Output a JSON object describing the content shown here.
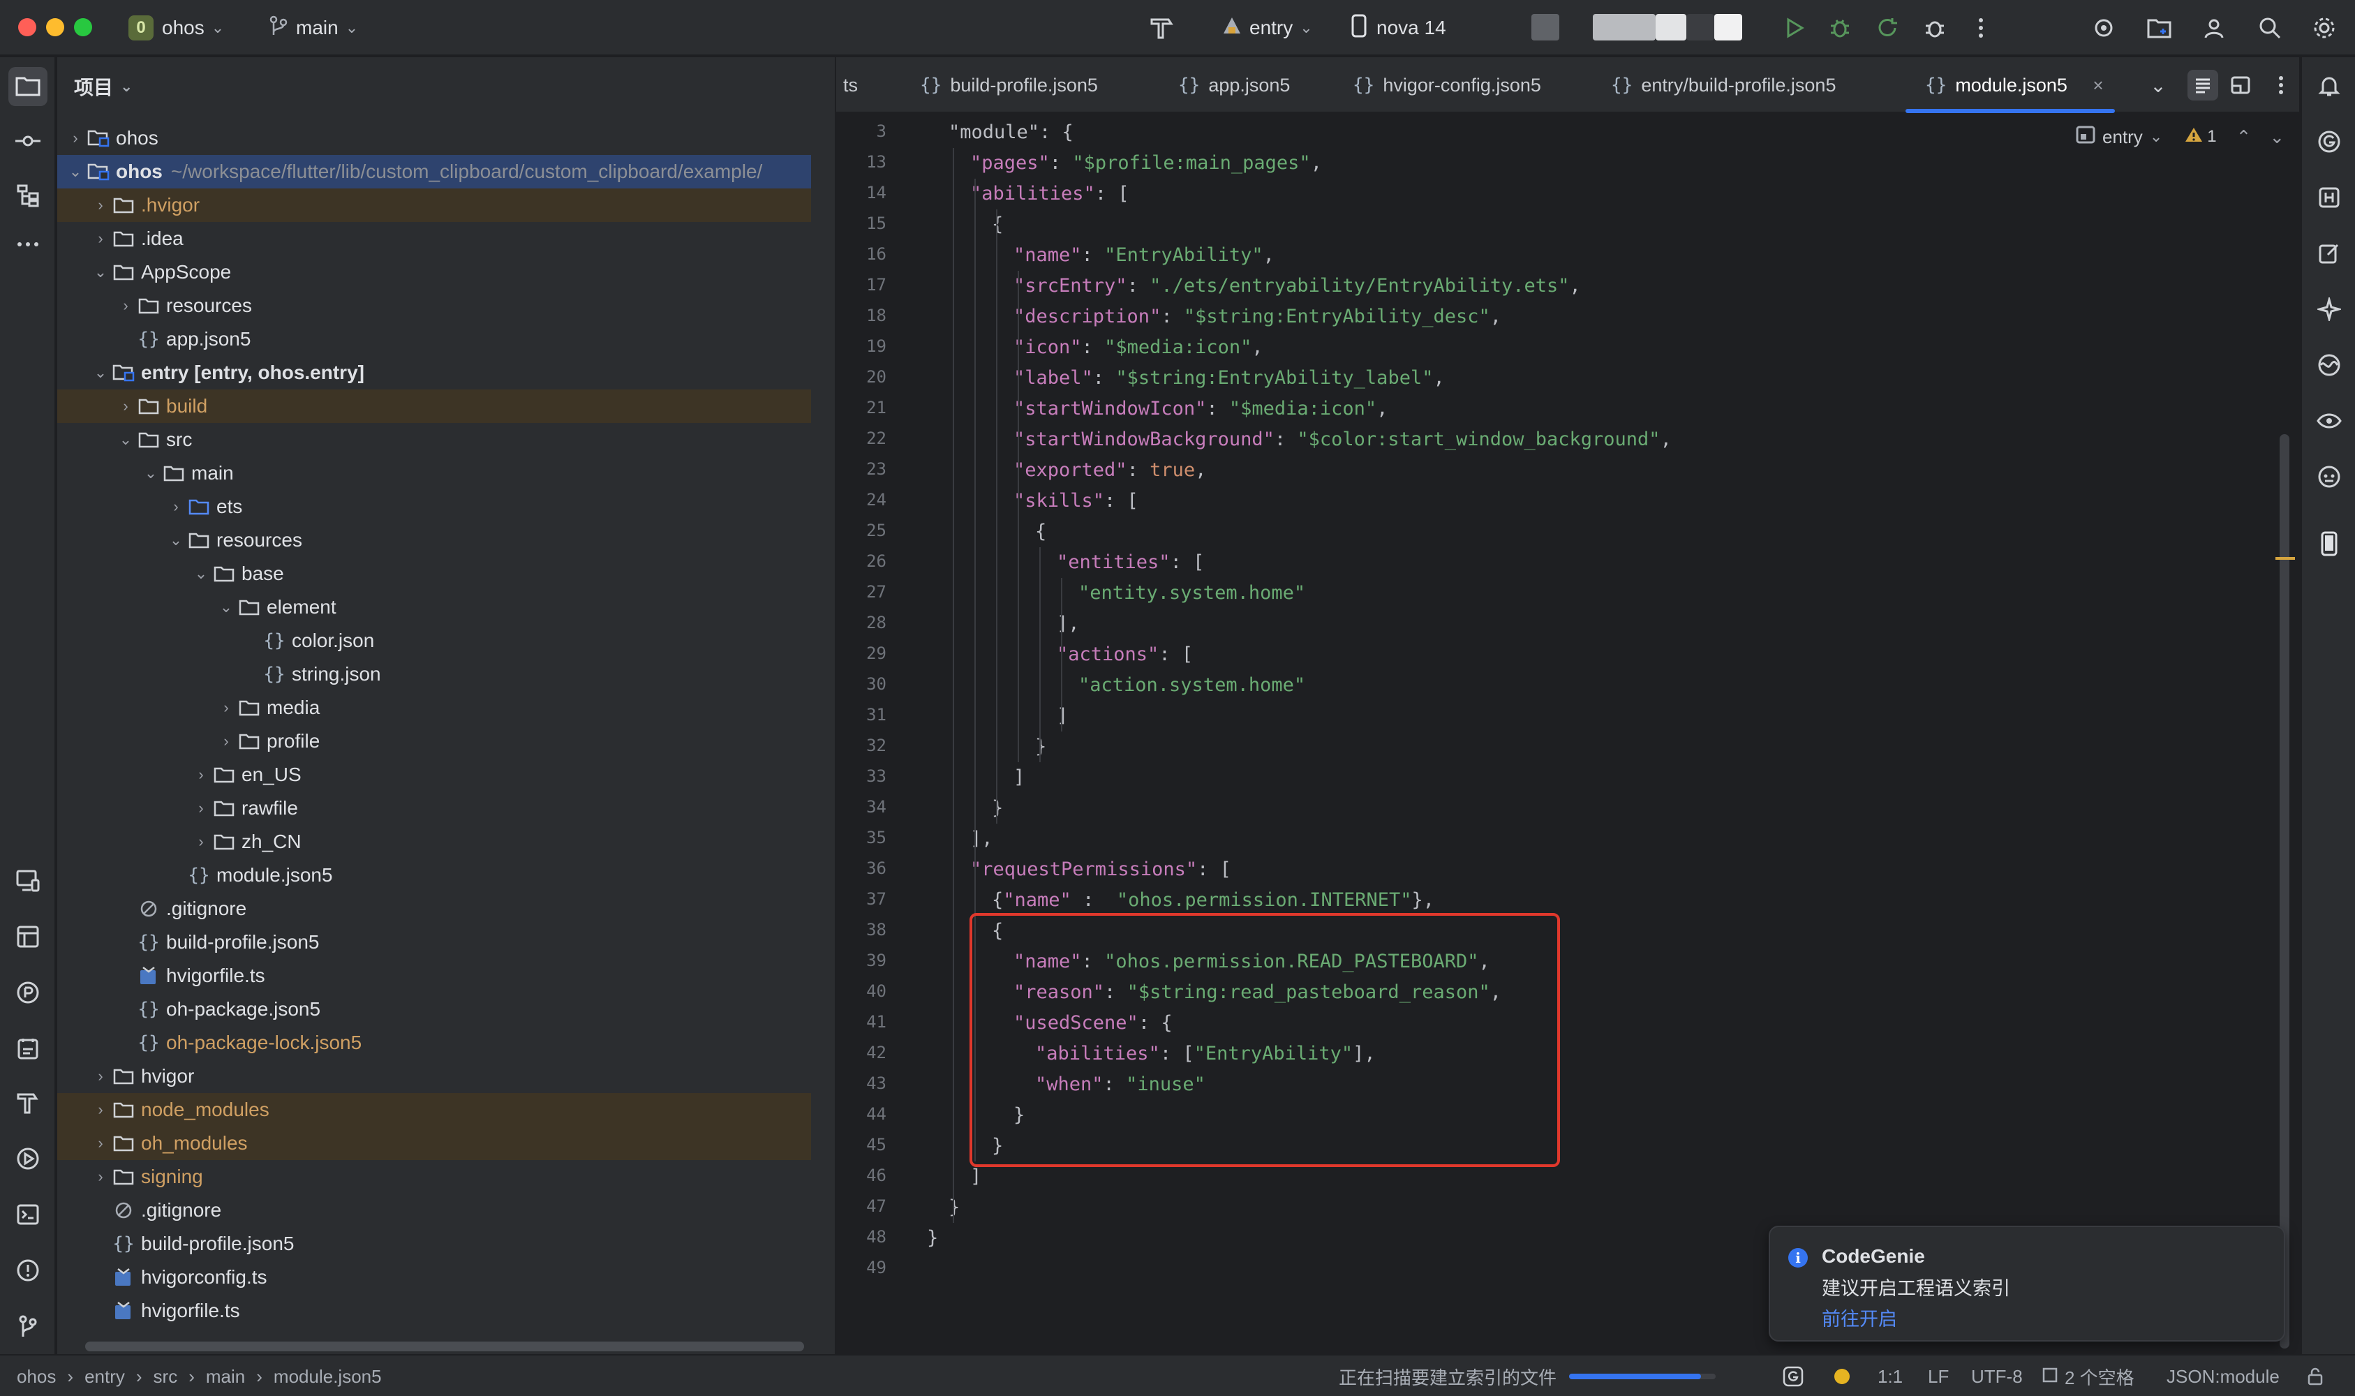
{
  "titlebar": {
    "project_badge": "0",
    "project_name": "ohos",
    "branch": "main",
    "run_config": "entry",
    "device": "nova 14"
  },
  "project_panel": {
    "title": "项目",
    "tree": [
      {
        "label": "ohos",
        "level": 0,
        "arrow": "›",
        "icon": "module-folder-icon",
        "style": "normal"
      },
      {
        "label": "ohos",
        "path": "~/workspace/flutter/lib/custom_clipboard/custom_clipboard/example/",
        "level": 0,
        "arrow": "⌄",
        "icon": "module-folder-icon",
        "style": "selected"
      },
      {
        "label": ".hvigor",
        "level": 1,
        "arrow": "›",
        "icon": "folder-icon",
        "style": "excluded"
      },
      {
        "label": ".idea",
        "level": 1,
        "arrow": "›",
        "icon": "folder-icon",
        "style": "normal"
      },
      {
        "label": "AppScope",
        "level": 1,
        "arrow": "⌄",
        "icon": "folder-icon",
        "style": "normal"
      },
      {
        "label": "resources",
        "level": 2,
        "arrow": "›",
        "icon": "folder-icon",
        "style": "normal"
      },
      {
        "label": "app.json5",
        "level": 2,
        "arrow": "",
        "icon": "json-icon",
        "style": "normal"
      },
      {
        "label": "entry [entry, ohos.entry]",
        "level": 1,
        "arrow": "⌄",
        "icon": "module-folder-icon",
        "style": "bold"
      },
      {
        "label": "build",
        "level": 2,
        "arrow": "›",
        "icon": "folder-icon",
        "style": "excluded"
      },
      {
        "label": "src",
        "level": 2,
        "arrow": "⌄",
        "icon": "folder-icon",
        "style": "normal"
      },
      {
        "label": "main",
        "level": 3,
        "arrow": "⌄",
        "icon": "folder-icon",
        "style": "normal"
      },
      {
        "label": "ets",
        "level": 4,
        "arrow": "›",
        "icon": "source-folder-icon",
        "style": "normal"
      },
      {
        "label": "resources",
        "level": 4,
        "arrow": "⌄",
        "icon": "folder-icon",
        "style": "normal"
      },
      {
        "label": "base",
        "level": 5,
        "arrow": "⌄",
        "icon": "folder-icon",
        "style": "normal"
      },
      {
        "label": "element",
        "level": 6,
        "arrow": "⌄",
        "icon": "folder-icon",
        "style": "normal"
      },
      {
        "label": "color.json",
        "level": 7,
        "arrow": "",
        "icon": "json-icon",
        "style": "normal"
      },
      {
        "label": "string.json",
        "level": 7,
        "arrow": "",
        "icon": "json-icon",
        "style": "normal"
      },
      {
        "label": "media",
        "level": 6,
        "arrow": "›",
        "icon": "folder-icon",
        "style": "normal"
      },
      {
        "label": "profile",
        "level": 6,
        "arrow": "›",
        "icon": "folder-icon",
        "style": "normal"
      },
      {
        "label": "en_US",
        "level": 5,
        "arrow": "›",
        "icon": "folder-icon",
        "style": "normal"
      },
      {
        "label": "rawfile",
        "level": 5,
        "arrow": "›",
        "icon": "folder-icon",
        "style": "normal"
      },
      {
        "label": "zh_CN",
        "level": 5,
        "arrow": "›",
        "icon": "folder-icon",
        "style": "normal"
      },
      {
        "label": "module.json5",
        "level": 4,
        "arrow": "",
        "icon": "json-icon",
        "style": "normal"
      },
      {
        "label": ".gitignore",
        "level": 2,
        "arrow": "",
        "icon": "ignore-icon",
        "style": "normal"
      },
      {
        "label": "build-profile.json5",
        "level": 2,
        "arrow": "",
        "icon": "json-icon",
        "style": "normal"
      },
      {
        "label": "hvigorfile.ts",
        "level": 2,
        "arrow": "",
        "icon": "ts-icon",
        "style": "normal"
      },
      {
        "label": "oh-package.json5",
        "level": 2,
        "arrow": "",
        "icon": "json-icon",
        "style": "normal"
      },
      {
        "label": "oh-package-lock.json5",
        "level": 2,
        "arrow": "",
        "icon": "json-icon",
        "style": "orange"
      },
      {
        "label": "hvigor",
        "level": 1,
        "arrow": "›",
        "icon": "folder-icon",
        "style": "normal"
      },
      {
        "label": "node_modules",
        "level": 1,
        "arrow": "›",
        "icon": "folder-icon",
        "style": "excluded"
      },
      {
        "label": "oh_modules",
        "level": 1,
        "arrow": "›",
        "icon": "folder-icon",
        "style": "excluded"
      },
      {
        "label": "signing",
        "level": 1,
        "arrow": "›",
        "icon": "folder-icon",
        "style": "orange"
      },
      {
        "label": ".gitignore",
        "level": 1,
        "arrow": "",
        "icon": "ignore-icon",
        "style": "normal"
      },
      {
        "label": "build-profile.json5",
        "level": 1,
        "arrow": "",
        "icon": "json-icon",
        "style": "normal"
      },
      {
        "label": "hvigorconfig.ts",
        "level": 1,
        "arrow": "",
        "icon": "ts-icon",
        "style": "normal"
      },
      {
        "label": "hvigorfile.ts",
        "level": 1,
        "arrow": "",
        "icon": "ts-icon",
        "style": "normal"
      }
    ]
  },
  "editor": {
    "tabs": [
      {
        "label": "ts",
        "active": false,
        "icon": false
      },
      {
        "label": "build-profile.json5",
        "active": false,
        "icon": true
      },
      {
        "label": "app.json5",
        "active": false,
        "icon": true
      },
      {
        "label": "hvigor-config.json5",
        "active": false,
        "icon": true
      },
      {
        "label": "entry/build-profile.json5",
        "active": false,
        "icon": true
      },
      {
        "label": "module.json5",
        "active": true,
        "icon": true
      }
    ],
    "context": "entry",
    "warning_count": "1",
    "lines": [
      {
        "n": "3",
        "indent": 1,
        "t": [
          [
            "p",
            "\"module\": {"
          ]
        ]
      },
      {
        "n": "13",
        "indent": 2,
        "t": [
          [
            "k",
            "\"pages\""
          ],
          [
            "p",
            ": "
          ],
          [
            "s",
            "\"$profile:main_pages\""
          ],
          [
            "p",
            ","
          ]
        ]
      },
      {
        "n": "14",
        "indent": 2,
        "t": [
          [
            "k",
            "\"abilities\""
          ],
          [
            "p",
            ": ["
          ]
        ]
      },
      {
        "n": "15",
        "indent": 3,
        "t": [
          [
            "p",
            "{"
          ]
        ]
      },
      {
        "n": "16",
        "indent": 4,
        "t": [
          [
            "k",
            "\"name\""
          ],
          [
            "p",
            ": "
          ],
          [
            "s",
            "\"EntryAbility\""
          ],
          [
            "p",
            ","
          ]
        ]
      },
      {
        "n": "17",
        "indent": 4,
        "t": [
          [
            "k",
            "\"srcEntry\""
          ],
          [
            "p",
            ": "
          ],
          [
            "s",
            "\"./ets/entryability/EntryAbility.ets\""
          ],
          [
            "p",
            ","
          ]
        ]
      },
      {
        "n": "18",
        "indent": 4,
        "t": [
          [
            "k",
            "\"description\""
          ],
          [
            "p",
            ": "
          ],
          [
            "s",
            "\"$string:EntryAbility_desc\""
          ],
          [
            "p",
            ","
          ]
        ]
      },
      {
        "n": "19",
        "indent": 4,
        "t": [
          [
            "k",
            "\"icon\""
          ],
          [
            "p",
            ": "
          ],
          [
            "s",
            "\"$media:icon\""
          ],
          [
            "p",
            ","
          ]
        ]
      },
      {
        "n": "20",
        "indent": 4,
        "t": [
          [
            "k",
            "\"label\""
          ],
          [
            "p",
            ": "
          ],
          [
            "s",
            "\"$string:EntryAbility_label\""
          ],
          [
            "p",
            ","
          ]
        ]
      },
      {
        "n": "21",
        "indent": 4,
        "t": [
          [
            "k",
            "\"startWindowIcon\""
          ],
          [
            "p",
            ": "
          ],
          [
            "s",
            "\"$media:icon\""
          ],
          [
            "p",
            ","
          ]
        ]
      },
      {
        "n": "22",
        "indent": 4,
        "t": [
          [
            "k",
            "\"startWindowBackground\""
          ],
          [
            "p",
            ": "
          ],
          [
            "s",
            "\"$color:start_window_background\""
          ],
          [
            "p",
            ","
          ]
        ]
      },
      {
        "n": "23",
        "indent": 4,
        "t": [
          [
            "k",
            "\"exported\""
          ],
          [
            "p",
            ": "
          ],
          [
            "b",
            "true"
          ],
          [
            "p",
            ","
          ]
        ]
      },
      {
        "n": "24",
        "indent": 4,
        "t": [
          [
            "k",
            "\"skills\""
          ],
          [
            "p",
            ": ["
          ]
        ]
      },
      {
        "n": "25",
        "indent": 5,
        "t": [
          [
            "p",
            "{"
          ]
        ]
      },
      {
        "n": "26",
        "indent": 6,
        "t": [
          [
            "k",
            "\"entities\""
          ],
          [
            "p",
            ": ["
          ]
        ]
      },
      {
        "n": "27",
        "indent": 7,
        "t": [
          [
            "s",
            "\"entity.system.home\""
          ]
        ]
      },
      {
        "n": "28",
        "indent": 6,
        "t": [
          [
            "p",
            "],"
          ]
        ]
      },
      {
        "n": "29",
        "indent": 6,
        "t": [
          [
            "k",
            "\"actions\""
          ],
          [
            "p",
            ": ["
          ]
        ]
      },
      {
        "n": "30",
        "indent": 7,
        "t": [
          [
            "s",
            "\"action.system.home\""
          ]
        ]
      },
      {
        "n": "31",
        "indent": 6,
        "t": [
          [
            "p",
            "]"
          ]
        ]
      },
      {
        "n": "32",
        "indent": 5,
        "t": [
          [
            "p",
            "}"
          ]
        ]
      },
      {
        "n": "33",
        "indent": 4,
        "t": [
          [
            "p",
            "]"
          ]
        ]
      },
      {
        "n": "34",
        "indent": 3,
        "t": [
          [
            "p",
            "}"
          ]
        ]
      },
      {
        "n": "35",
        "indent": 2,
        "t": [
          [
            "p",
            "],"
          ]
        ]
      },
      {
        "n": "36",
        "indent": 2,
        "t": [
          [
            "k",
            "\"requestPermissions\""
          ],
          [
            "p",
            ": ["
          ]
        ]
      },
      {
        "n": "37",
        "indent": 3,
        "t": [
          [
            "p",
            "{"
          ],
          [
            "k",
            "\"name\""
          ],
          [
            "p",
            " :  "
          ],
          [
            "s",
            "\"ohos.permission.INTERNET\""
          ],
          [
            "p",
            "},"
          ]
        ]
      },
      {
        "n": "38",
        "indent": 3,
        "t": [
          [
            "p",
            "{"
          ]
        ]
      },
      {
        "n": "39",
        "indent": 4,
        "t": [
          [
            "k",
            "\"name\""
          ],
          [
            "p",
            ": "
          ],
          [
            "s",
            "\"ohos.permission.READ_PASTEBOARD\""
          ],
          [
            "p",
            ","
          ]
        ]
      },
      {
        "n": "40",
        "indent": 4,
        "t": [
          [
            "k",
            "\"reason\""
          ],
          [
            "p",
            ": "
          ],
          [
            "s",
            "\"$string:read_pasteboard_reason\""
          ],
          [
            "p",
            ","
          ]
        ]
      },
      {
        "n": "41",
        "indent": 4,
        "t": [
          [
            "k",
            "\"usedScene\""
          ],
          [
            "p",
            ": {"
          ]
        ]
      },
      {
        "n": "42",
        "indent": 5,
        "t": [
          [
            "k",
            "\"abilities\""
          ],
          [
            "p",
            ": ["
          ],
          [
            "s",
            "\"EntryAbility\""
          ],
          [
            "p",
            "],"
          ]
        ]
      },
      {
        "n": "43",
        "indent": 5,
        "t": [
          [
            "k",
            "\"when\""
          ],
          [
            "p",
            ": "
          ],
          [
            "s",
            "\"inuse\""
          ]
        ]
      },
      {
        "n": "44",
        "indent": 4,
        "t": [
          [
            "p",
            "}"
          ]
        ]
      },
      {
        "n": "45",
        "indent": 3,
        "t": [
          [
            "p",
            "}"
          ]
        ]
      },
      {
        "n": "46",
        "indent": 2,
        "t": [
          [
            "p",
            "]"
          ]
        ]
      },
      {
        "n": "47",
        "indent": 1,
        "t": [
          [
            "p",
            "}"
          ]
        ]
      },
      {
        "n": "48",
        "indent": 0,
        "t": [
          [
            "p",
            "}"
          ]
        ]
      },
      {
        "n": "49",
        "indent": 0,
        "t": []
      }
    ]
  },
  "notification": {
    "title": "CodeGenie",
    "message": "建议开启工程语义索引",
    "link": "前往开启"
  },
  "statusbar": {
    "crumbs": [
      "ohos",
      "entry",
      "src",
      "main",
      "module.json5"
    ],
    "indexing": "正在扫描要建立索引的文件",
    "progress_fraction": 0.9,
    "position": "1:1",
    "line_sep": "LF",
    "encoding": "UTF-8",
    "indent": "2 个空格",
    "schema": "JSON:module"
  },
  "colors": {
    "accent": "#3574f0",
    "highlight_box": "#e0382c",
    "excluded_bg": "#3d3425",
    "orange_text": "#d0a063"
  }
}
